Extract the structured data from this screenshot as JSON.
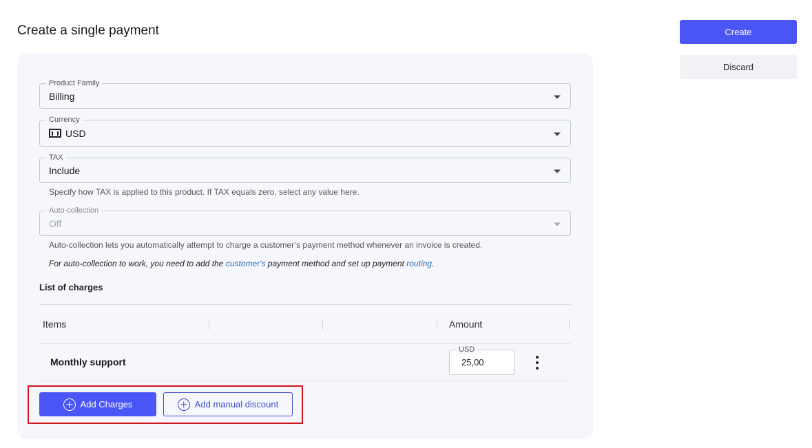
{
  "page": {
    "title": "Create a single payment"
  },
  "actions": {
    "create_label": "Create",
    "discard_label": "Discard"
  },
  "form": {
    "product_family": {
      "label": "Product Family",
      "value": "Billing"
    },
    "currency": {
      "label": "Currency",
      "value": "USD",
      "icon": "money-bill-icon"
    },
    "tax": {
      "label": "TAX",
      "value": "Include",
      "helper": "Specify how TAX is applied to this product. If TAX equals zero, select any value here."
    },
    "auto_collection": {
      "label": "Auto-collection",
      "value": "Off",
      "disabled": true,
      "helper": "Auto-collection lets you automatically attempt to charge a customer’s payment method whenever an invoice is created."
    },
    "note": {
      "before": "For auto-collection to work, you need to add the ",
      "link1": "customer's",
      "middle": " payment method and set up payment ",
      "link2": "routing",
      "after": "."
    }
  },
  "charges": {
    "title": "List of charges",
    "columns": {
      "items": "Items",
      "amount": "Amount"
    },
    "rows": [
      {
        "name": "Monthly support",
        "currency": "USD",
        "amount": "25,00"
      }
    ]
  },
  "buttons": {
    "add_charges": "Add Charges",
    "add_manual_discount": "Add manual discount"
  },
  "colors": {
    "primary": "#4a55f5",
    "card_bg": "#f5f7fd",
    "highlight": "#d3151d",
    "link": "#2b6cb0"
  }
}
